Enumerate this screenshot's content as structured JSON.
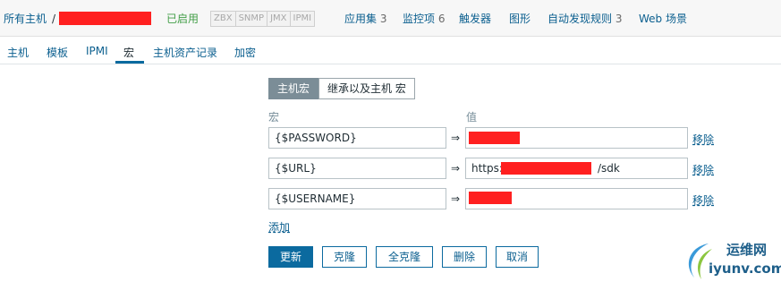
{
  "breadcrumb": {
    "all_hosts": "所有主机",
    "separator": "/"
  },
  "status": {
    "enabled": "已启用"
  },
  "availability_tags": [
    "ZBX",
    "SNMP",
    "JMX",
    "IPMI"
  ],
  "top_nav": [
    {
      "label": "应用集",
      "count": "3"
    },
    {
      "label": "监控项",
      "count": "6"
    },
    {
      "label": "触发器",
      "count": ""
    },
    {
      "label": "图形",
      "count": ""
    },
    {
      "label": "自动发现规则",
      "count": "3"
    },
    {
      "label": "Web 场景",
      "count": ""
    }
  ],
  "sub_tabs": [
    "主机",
    "模板",
    "IPMI",
    "宏",
    "主机资产记录",
    "加密"
  ],
  "active_tab": "宏",
  "macro_mode": {
    "host_macros": "主机宏",
    "inherited_macros": "继承以及主机 宏"
  },
  "columns": {
    "macro": "宏",
    "value": "值"
  },
  "macros": [
    {
      "name": "{$PASSWORD}",
      "value_prefix": "",
      "value_suffix": "",
      "remove": "移除"
    },
    {
      "name": "{$URL}",
      "value_prefix": "https:/",
      "value_suffix": "/sdk",
      "remove": "移除"
    },
    {
      "name": "{$USERNAME}",
      "value_prefix": "",
      "value_suffix": "",
      "remove": "移除"
    }
  ],
  "arrow": "⇒",
  "add_label": "添加",
  "buttons": {
    "update": "更新",
    "clone": "克隆",
    "full_clone": "全克隆",
    "delete": "删除",
    "cancel": "取消"
  },
  "watermark": {
    "line1": "运维网",
    "line2": "iyunv.com"
  },
  "colors": {
    "accent": "#0b6a9f",
    "link": "#0b5f8f",
    "enabled": "#429e47",
    "redaction": "#ff2020"
  }
}
